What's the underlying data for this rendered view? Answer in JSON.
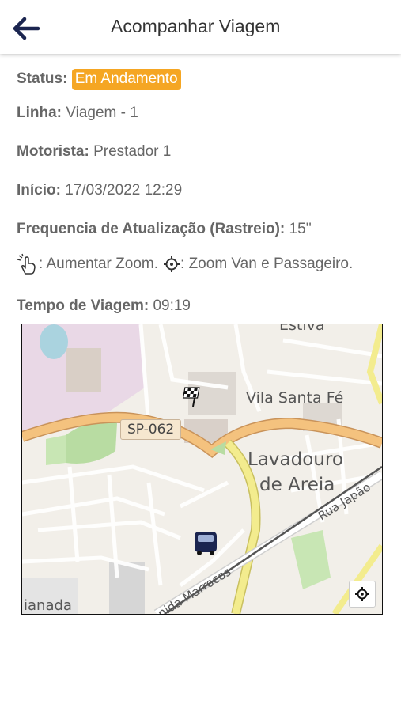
{
  "header": {
    "title": "Acompanhar Viagem"
  },
  "trip": {
    "status_label": "Status:",
    "status_value": "Em Andamento",
    "linha_label": "Linha:",
    "linha_value": "Viagem - 1",
    "motorista_label": "Motorista:",
    "motorista_value": "Prestador 1",
    "inicio_label": "Início:",
    "inicio_value": "17/03/2022 12:29",
    "frequencia_label": "Frequencia de Atualização (Rastreio):",
    "frequencia_value": "15''",
    "zoom_hint_1": ": Aumentar Zoom.",
    "zoom_hint_2": ": Zoom Van e Passageiro.",
    "tempo_label": "Tempo de Viagem:",
    "tempo_value": "09:19"
  },
  "map": {
    "labels": {
      "estiva": "Estiva",
      "vila": "Vila Santa Fé",
      "lavadouro_1": "Lavadouro",
      "lavadouro_2": "de Areia",
      "rua_japao": "Rua Japão",
      "avenida": "nida Marrocos",
      "chanada": "ianada",
      "road_shield": "SP-062"
    },
    "colors": {
      "road_major": "#f4c27e",
      "road_yellow": "#f3ec8e",
      "park": "#b8dca2",
      "water": "#aad3df"
    }
  }
}
